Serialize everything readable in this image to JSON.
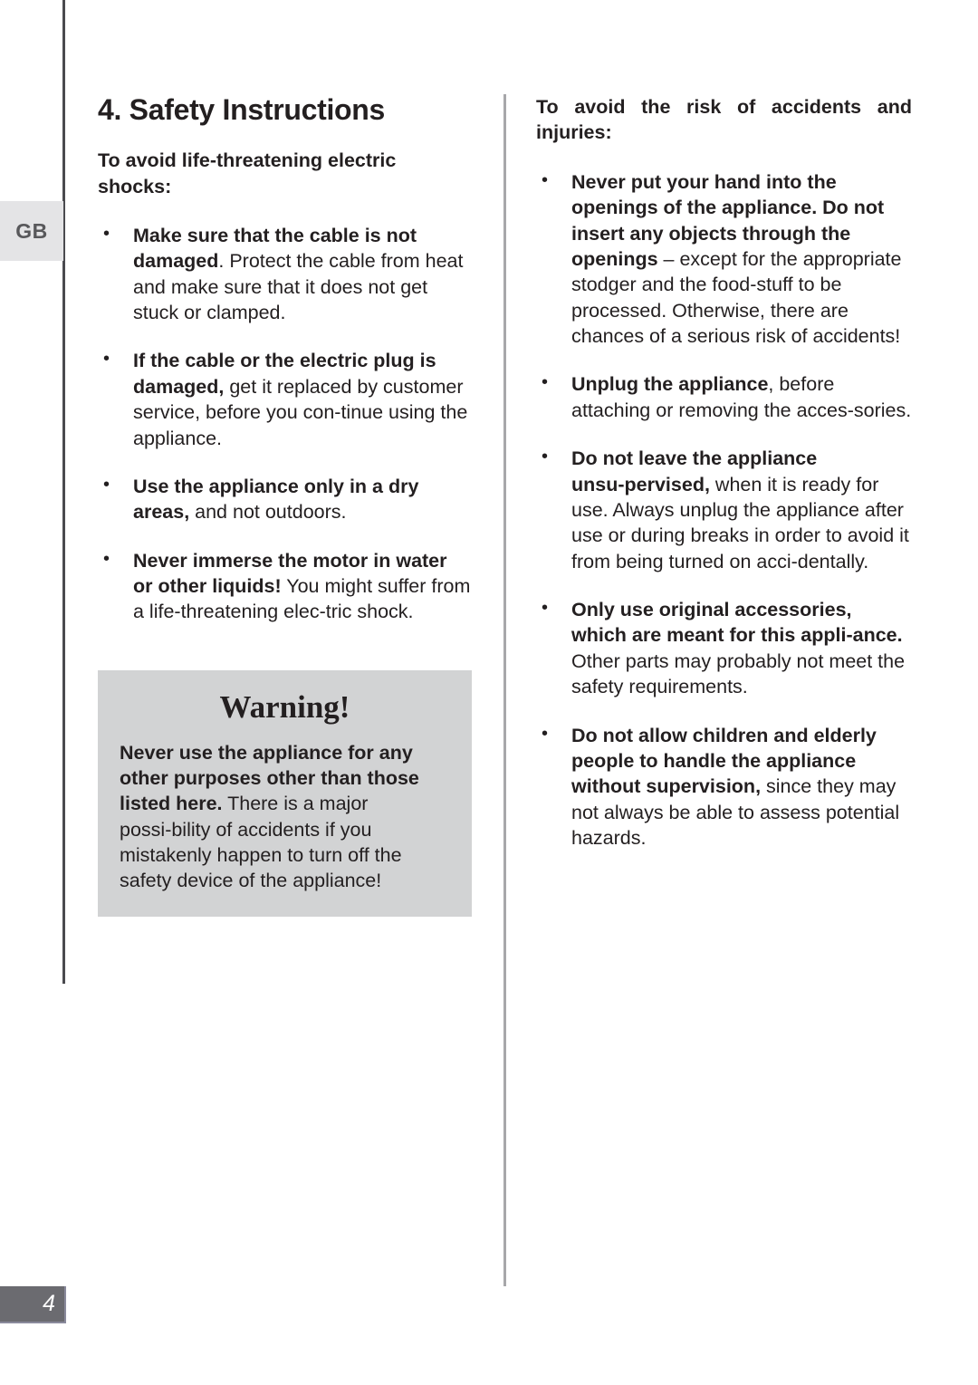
{
  "page": {
    "language_tab": "GB",
    "page_number": "4"
  },
  "left_column": {
    "section_title": "4. Safety Instructions",
    "lead": "To avoid life-threatening electric shocks:",
    "bullets": [
      {
        "bold": "Make sure that the cable is not damaged",
        "rest": ". Protect the cable from heat and make sure that it does not get stuck or clamped."
      },
      {
        "bold": "If the cable or the electric plug is damaged,",
        "rest": " get it replaced by customer service, before you con‑tinue using the appliance."
      },
      {
        "bold": "Use the appliance only in a dry areas,",
        "rest": " and not outdoors."
      },
      {
        "bold": "Never immerse the motor in water or other liquids!",
        "rest": " You might suffer from a life-threatening elec‑tric shock."
      }
    ]
  },
  "warning": {
    "title": "Warning!",
    "bold": "Never use the appliance for any other purposes other than those listed here.",
    "rest": " There is a major possi‑bility of accidents if you mistakenly happen to turn off the safety device of the appliance!"
  },
  "right_column": {
    "lead": "To avoid the risk of accidents and injuries:",
    "bullets": [
      {
        "bold": "Never put your hand into the openings of the appliance. Do not insert any objects through the openings",
        "rest": " – except for the appropriate stodger and the food-stuff to be processed. Otherwise, there are chances of a serious risk of accidents!"
      },
      {
        "bold": "Unplug the appliance",
        "rest": ", before attaching or removing the acces‑sories."
      },
      {
        "bold": "Do not leave the appliance unsu‑pervised,",
        "rest": " when it is ready for use. Always unplug the appliance after use or during breaks in order to avoid it from being turned on acci‑dentally."
      },
      {
        "bold": "Only use original accessories, which are meant for this appli‑ance.",
        "rest": " Other parts may probably not meet the safety requirements."
      },
      {
        "bold": "Do not allow children and elderly people to handle the appliance without supervision,",
        "rest": " since they may not always be able to assess potential hazards."
      }
    ]
  },
  "colors": {
    "text": "#231f20",
    "warning_background": "#d2d3d4",
    "language_tab_background": "#e4e4e6",
    "page_number_background": "#6b6b70",
    "rule_dark": "#4a4a4f",
    "rule_light": "#a7a7aa"
  }
}
